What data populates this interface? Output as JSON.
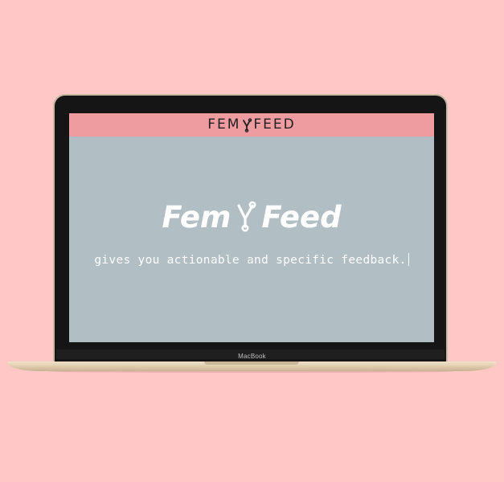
{
  "nav": {
    "logo_left": "FEM",
    "logo_right": "FEED",
    "logo_icon": "fork-icon"
  },
  "hero": {
    "title_left": "Fem",
    "title_right": "Feed",
    "title_icon": "fork-icon",
    "tagline": "gives you actionable and specific feedback."
  },
  "device": {
    "label": "MacBook"
  },
  "colors": {
    "background": "#ffc8c6",
    "nav_bar": "#ee9c9f",
    "screen": "#b1bec4",
    "text_light": "#ffffff",
    "text_dark": "#222222"
  }
}
